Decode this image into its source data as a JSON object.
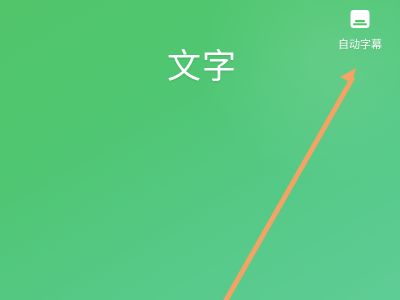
{
  "canvas": {
    "background_top": "#52c56a",
    "background_bottom": "#5fcc96"
  },
  "editor": {
    "text_sticker": "文字"
  },
  "toolbar": {
    "auto_caption_label": "自动字幕",
    "auto_caption_icon": "subtitle-icon"
  },
  "annotation": {
    "arrow_color": "#f3a364"
  }
}
